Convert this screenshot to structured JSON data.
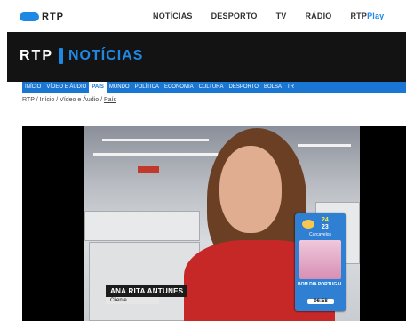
{
  "topbar": {
    "logo": "RTP",
    "nav": [
      "NOTÍCIAS",
      "DESPORTO",
      "TV",
      "RÁDIO"
    ],
    "play_prefix": "RTP",
    "play_accent": "Play"
  },
  "brand": {
    "rtp": "RTP",
    "section": "NOTÍCIAS"
  },
  "secnav": [
    "INÍCIO",
    "VÍDEO E ÁUDIO",
    "PAÍS",
    "MUNDO",
    "POLÍTICA",
    "ECONOMIA",
    "CULTURA",
    "DESPORTO",
    "BOLSA",
    "TR"
  ],
  "secnav_active": "PAÍS",
  "breadcrumb": {
    "path": "RTP / Início / Vídeo e Áudio / ",
    "current": "País"
  },
  "video": {
    "caption_name": "ANA RITA ANTUNES",
    "caption_role": "Cliente",
    "weather": {
      "high": "24",
      "low": "23",
      "city": "Carcavelos",
      "show": "BOM DIA PORTUGAL",
      "time": "06:58"
    }
  },
  "colors": {
    "accent": "#1e88e5",
    "nav_bg": "#1976d2",
    "header_bg": "#131313"
  }
}
